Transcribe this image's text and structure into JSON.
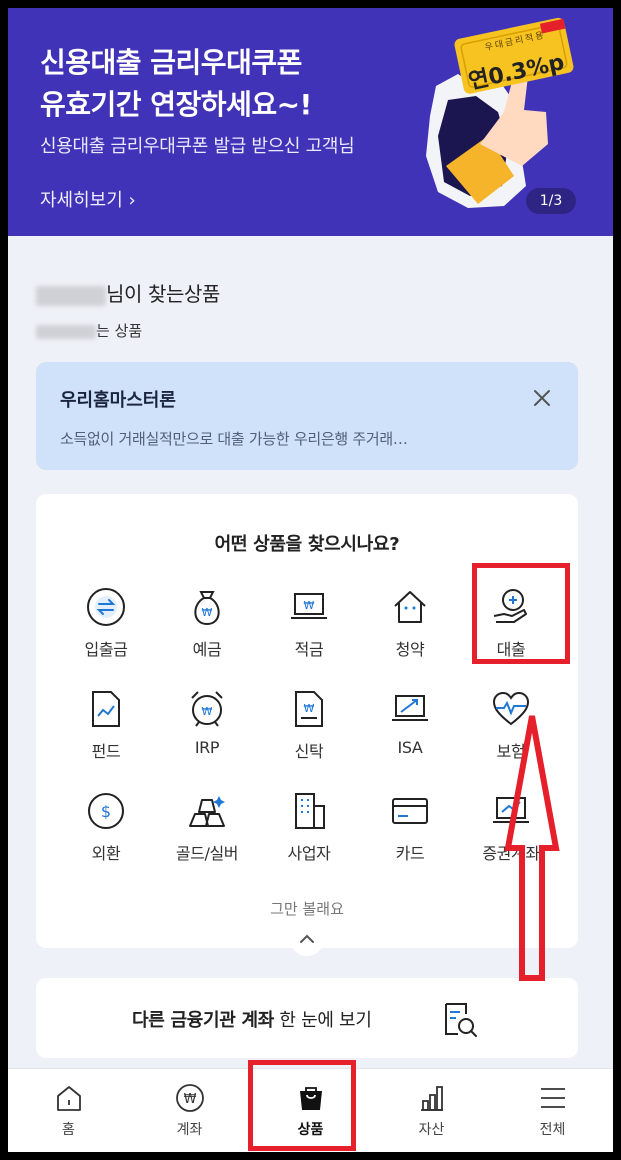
{
  "banner": {
    "title_line1": "신용대출 금리우대쿠폰",
    "title_line2": "유효기간 연장하세요~!",
    "subtitle": "신용대출 금리우대쿠폰 발급 받으신 고객님",
    "more_link": "자세히보기 ›",
    "page_indicator": "1/3",
    "coupon_caption": "우대금리적용",
    "coupon_value": "연0.3%p",
    "background_color": "#4133b7",
    "coupon_color": "#f6c321"
  },
  "recommend": {
    "title_suffix": "님이 찾는상품",
    "subtitle_suffix": "는 상품"
  },
  "promo": {
    "title": "우리홈마스터론",
    "description": "소득없이 거래실적만으로 대출 가능한 우리은행 주거래…",
    "close_icon": "close-icon",
    "background_color": "#cfe2f9"
  },
  "product_finder": {
    "title": "어떤 상품을 찾으시나요?",
    "items": [
      {
        "label": "입출금",
        "icon": "transfer-icon"
      },
      {
        "label": "예금",
        "icon": "money-bag-icon"
      },
      {
        "label": "적금",
        "icon": "laptop-won-icon"
      },
      {
        "label": "청약",
        "icon": "house-icon"
      },
      {
        "label": "대출",
        "icon": "hand-coin-icon"
      },
      {
        "label": "펀드",
        "icon": "fund-document-icon"
      },
      {
        "label": "IRP",
        "icon": "alarm-clock-icon"
      },
      {
        "label": "신탁",
        "icon": "trust-document-icon"
      },
      {
        "label": "ISA",
        "icon": "chart-monitor-icon"
      },
      {
        "label": "보험",
        "icon": "heart-pulse-icon"
      },
      {
        "label": "외환",
        "icon": "dollar-coin-icon"
      },
      {
        "label": "골드/실버",
        "icon": "gold-bars-icon"
      },
      {
        "label": "사업자",
        "icon": "building-icon"
      },
      {
        "label": "카드",
        "icon": "credit-card-icon"
      },
      {
        "label": "증권계좌",
        "icon": "stock-laptop-icon"
      }
    ],
    "collapse_label": "그만 볼래요"
  },
  "other_accounts": {
    "bold_text": "다른 금융기관 계좌",
    "rest_text": " 한 눈에 보기",
    "icon": "document-search-icon"
  },
  "tabbar": {
    "tabs": [
      {
        "label": "홈",
        "icon": "home-icon",
        "active": false
      },
      {
        "label": "계좌",
        "icon": "won-coin-icon",
        "active": false
      },
      {
        "label": "상품",
        "icon": "shopping-bag-icon",
        "active": true
      },
      {
        "label": "자산",
        "icon": "bar-chart-icon",
        "active": false
      },
      {
        "label": "전체",
        "icon": "menu-icon",
        "active": false
      }
    ]
  },
  "annotation": {
    "highlight_color": "#e6202a"
  }
}
